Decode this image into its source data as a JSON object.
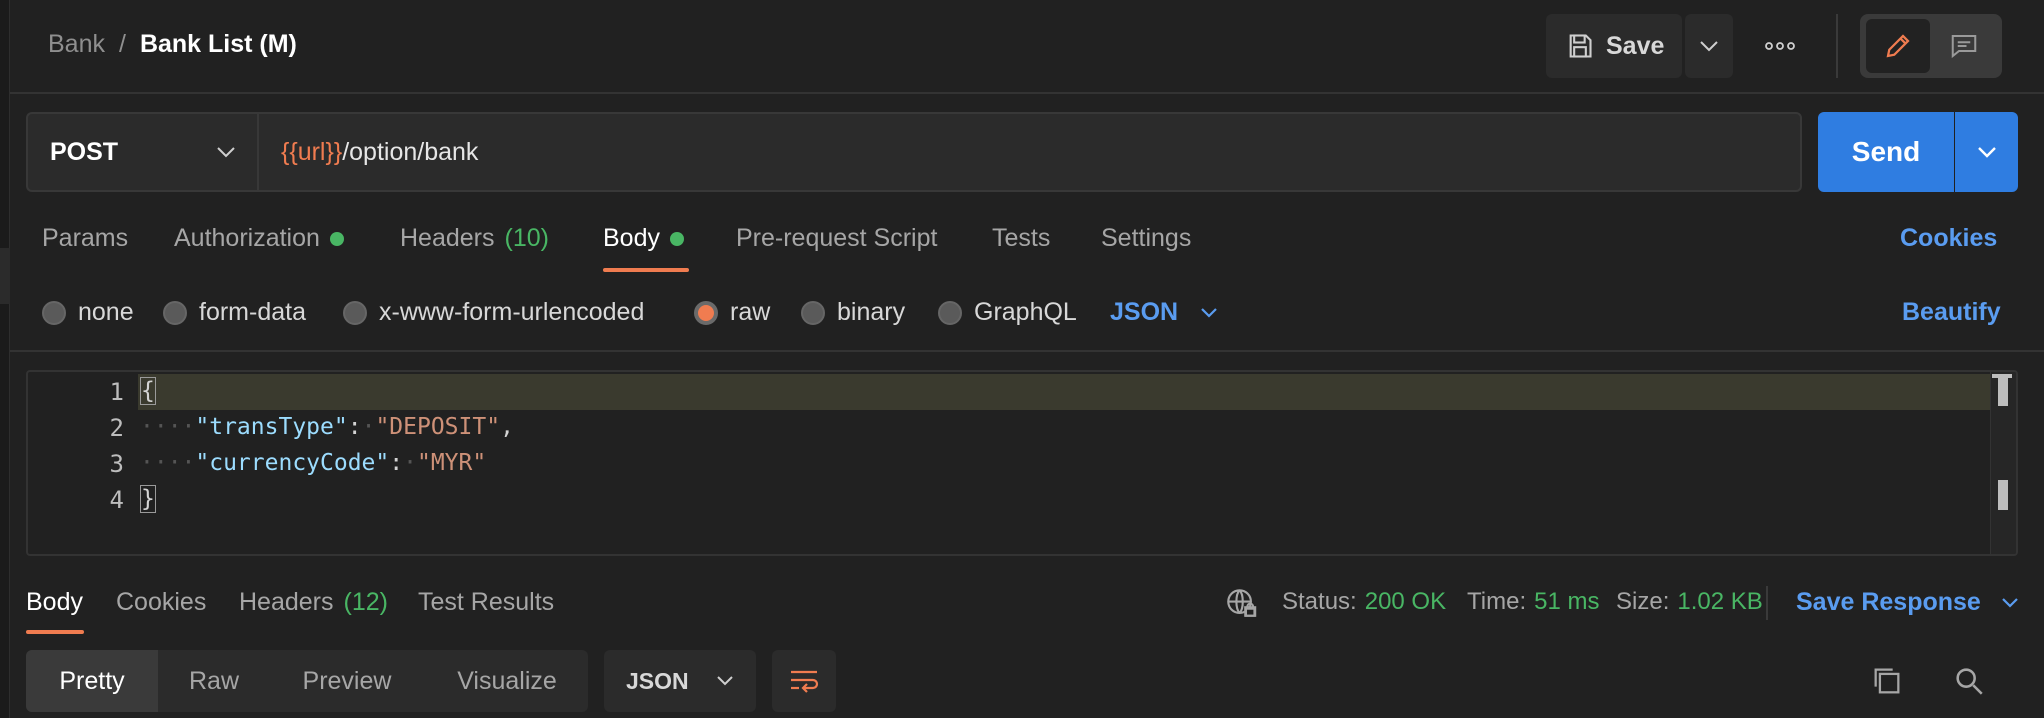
{
  "colors": {
    "background": "#212121",
    "accent_orange": "#f07c50",
    "link_blue": "#5a9cf0",
    "send_blue": "#2f7de1",
    "status_green": "#49b664"
  },
  "breadcrumb": {
    "root": "Bank",
    "separator": "/",
    "current": "Bank List (M)"
  },
  "toolbar": {
    "save_label": "Save",
    "save_icon": "floppy-icon",
    "more_icon": "more-icon",
    "edit_icon": "pencil-icon",
    "comment_icon": "comment-icon"
  },
  "request": {
    "method": "POST",
    "url_variable": "{{url}}",
    "url_path": "/option/bank",
    "send_label": "Send"
  },
  "request_tabs": [
    {
      "label": "Params"
    },
    {
      "label": "Authorization",
      "has_dot": true
    },
    {
      "label": "Headers",
      "count": "(10)"
    },
    {
      "label": "Body",
      "has_dot": true,
      "active": true
    },
    {
      "label": "Pre-request Script"
    },
    {
      "label": "Tests"
    },
    {
      "label": "Settings"
    }
  ],
  "cookies_label": "Cookies",
  "body_types": [
    {
      "label": "none"
    },
    {
      "label": "form-data"
    },
    {
      "label": "x-www-form-urlencoded"
    },
    {
      "label": "raw",
      "selected": true
    },
    {
      "label": "binary"
    },
    {
      "label": "GraphQL"
    }
  ],
  "body_format": "JSON",
  "beautify_label": "Beautify",
  "editor": {
    "line_numbers": [
      "1",
      "2",
      "3",
      "4"
    ],
    "open_brace": "{",
    "close_brace": "}",
    "indent_marker": "····",
    "lines": [
      {
        "key": "\"transType\"",
        "colon": ":",
        "space_marker": "·",
        "value": "\"DEPOSIT\"",
        "trail": ","
      },
      {
        "key": "\"currencyCode\"",
        "colon": ":",
        "space_marker": "·",
        "value": "\"MYR\"",
        "trail": ""
      }
    ]
  },
  "response_tabs": [
    {
      "label": "Body",
      "active": true
    },
    {
      "label": "Cookies"
    },
    {
      "label": "Headers",
      "count": "(12)"
    },
    {
      "label": "Test Results"
    }
  ],
  "response_meta": {
    "network_icon": "globe-lock-icon",
    "status_label": "Status:",
    "status_value": "200 OK",
    "time_label": "Time:",
    "time_value": "51 ms",
    "size_label": "Size:",
    "size_value": "1.02 KB",
    "save_response_label": "Save Response"
  },
  "response_views": [
    {
      "label": "Pretty",
      "active": true
    },
    {
      "label": "Raw"
    },
    {
      "label": "Preview"
    },
    {
      "label": "Visualize"
    }
  ],
  "response_format": "JSON",
  "response_icons": {
    "wrap": "wrap-lines-icon",
    "copy": "copy-icon",
    "search": "search-icon"
  }
}
